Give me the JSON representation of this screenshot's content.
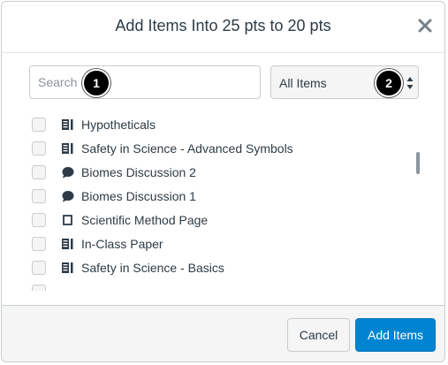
{
  "dialog": {
    "title": "Add Items Into 25 pts to 20 pts",
    "close_icon": "close-icon"
  },
  "filters": {
    "search_placeholder": "Search",
    "search_value": "",
    "type_select_value": "All Items"
  },
  "callouts": [
    "1",
    "2"
  ],
  "items": [
    {
      "label": "Hypotheticals",
      "icon": "quiz-icon"
    },
    {
      "label": "Safety in Science - Advanced Symbols",
      "icon": "quiz-icon"
    },
    {
      "label": "Biomes Discussion 2",
      "icon": "discussion-icon"
    },
    {
      "label": "Biomes Discussion 1",
      "icon": "discussion-icon"
    },
    {
      "label": "Scientific Method Page",
      "icon": "page-icon"
    },
    {
      "label": "In-Class Paper",
      "icon": "quiz-icon"
    },
    {
      "label": "Safety in Science - Basics",
      "icon": "quiz-icon"
    }
  ],
  "footer": {
    "cancel_label": "Cancel",
    "add_label": "Add Items"
  },
  "colors": {
    "primary": "#0084d1",
    "text": "#2d3b45",
    "border": "#c7cdd1",
    "footer_bg": "#f5f5f5"
  }
}
